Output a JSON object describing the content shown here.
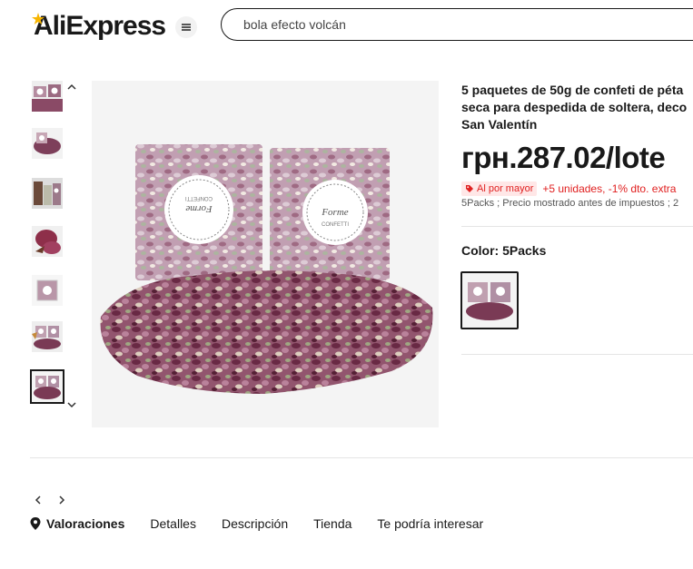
{
  "header": {
    "logo_text": "AliExpress",
    "search_value": "bola efecto volcán"
  },
  "gallery": {
    "thumbnail_count": 7,
    "active_index": 6
  },
  "product": {
    "title_lines": [
      "5 paquetes de 50g de confeti de péta",
      "seca para despedida de soltera, deco",
      "San Valentín"
    ],
    "price": "грн.287.02/lote",
    "promo_badge": "Al por mayor",
    "promo_text": "+5 unidades, -1% dto. extra",
    "tax_note": "5Packs ; Precio mostrado antes de impuestos ; 2",
    "color_label": "Color: 5Packs",
    "package_label_a": "Forme",
    "package_label_b": "CONFETTI"
  },
  "tabs": [
    {
      "label": "Valoraciones",
      "icon": "location-pin-icon"
    },
    {
      "label": "Detalles"
    },
    {
      "label": "Descripción"
    },
    {
      "label": "Tienda"
    },
    {
      "label": "Te podría interesar"
    }
  ],
  "colors": {
    "accent_red": "#e02020",
    "petal_dark": "#7a3a55",
    "petal_light": "#c9a6b6"
  }
}
